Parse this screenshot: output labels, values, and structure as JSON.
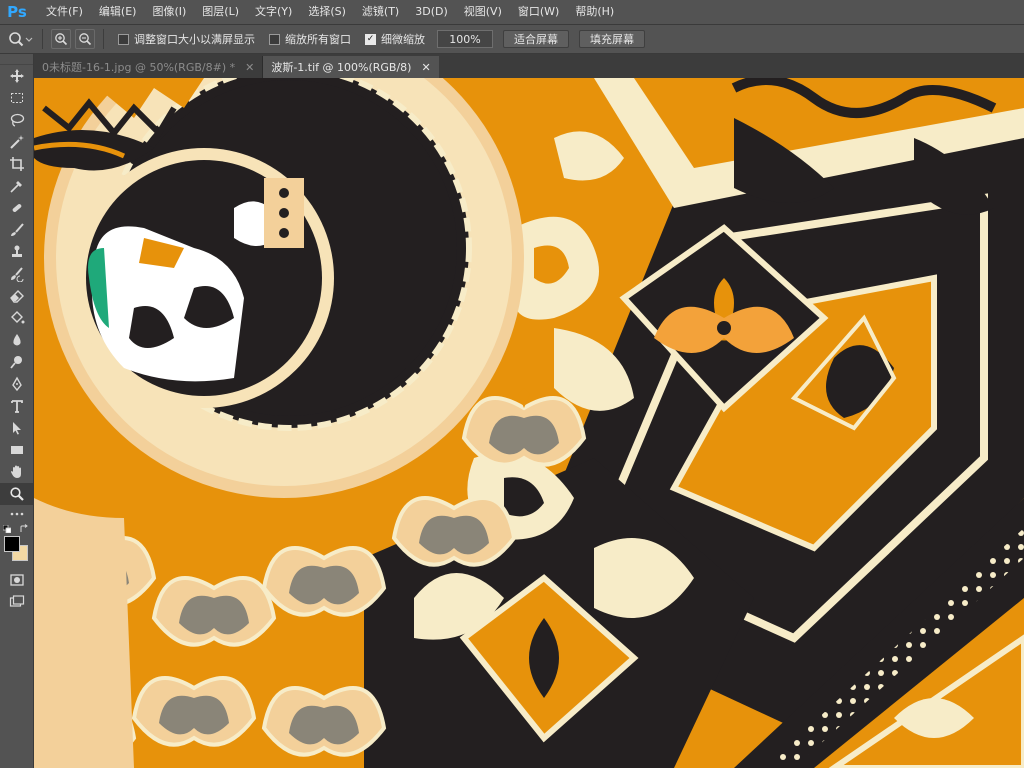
{
  "app": {
    "logo": "Ps"
  },
  "menu": [
    "文件(F)",
    "编辑(E)",
    "图像(I)",
    "图层(L)",
    "文字(Y)",
    "选择(S)",
    "滤镜(T)",
    "3D(D)",
    "视图(V)",
    "窗口(W)",
    "帮助(H)"
  ],
  "options": {
    "resize_windows": {
      "label": "调整窗口大小以满屏显示",
      "checked": false
    },
    "zoom_all": {
      "label": "缩放所有窗口",
      "checked": false
    },
    "scrubby_zoom": {
      "label": "细微缩放",
      "checked": true
    },
    "zoom_value": "100%",
    "fit_screen": "适合屏幕",
    "fill_screen": "填充屏幕"
  },
  "tabs": [
    {
      "title": "0未标题-16-1.jpg @ 50%(RGB/8#) *",
      "active": false
    },
    {
      "title": "波斯-1.tif @ 100%(RGB/8)",
      "active": true
    }
  ],
  "toolbox": {
    "tools": [
      "move-tool",
      "marquee-tool",
      "lasso-tool",
      "quick-select-tool",
      "crop-tool",
      "eyedropper-tool",
      "healing-brush-tool",
      "brush-tool",
      "clone-stamp-tool",
      "history-brush-tool",
      "eraser-tool",
      "paint-bucket-tool",
      "blur-tool",
      "dodge-tool",
      "pen-tool",
      "type-tool",
      "path-select-tool",
      "rectangle-tool",
      "hand-tool",
      "zoom-tool"
    ],
    "selected": "zoom-tool",
    "foreground_color": "#000000",
    "background_color": "#f3d9a4"
  },
  "colors": {
    "ui_dark": "#282828",
    "ui_mid": "#535353",
    "pattern_orange": "#e7920b",
    "pattern_black": "#231f20",
    "pattern_cream": "#f7ecc8",
    "pattern_tan": "#f3d09a",
    "pattern_gray": "#8a8578",
    "pattern_green": "#1fa97a"
  }
}
